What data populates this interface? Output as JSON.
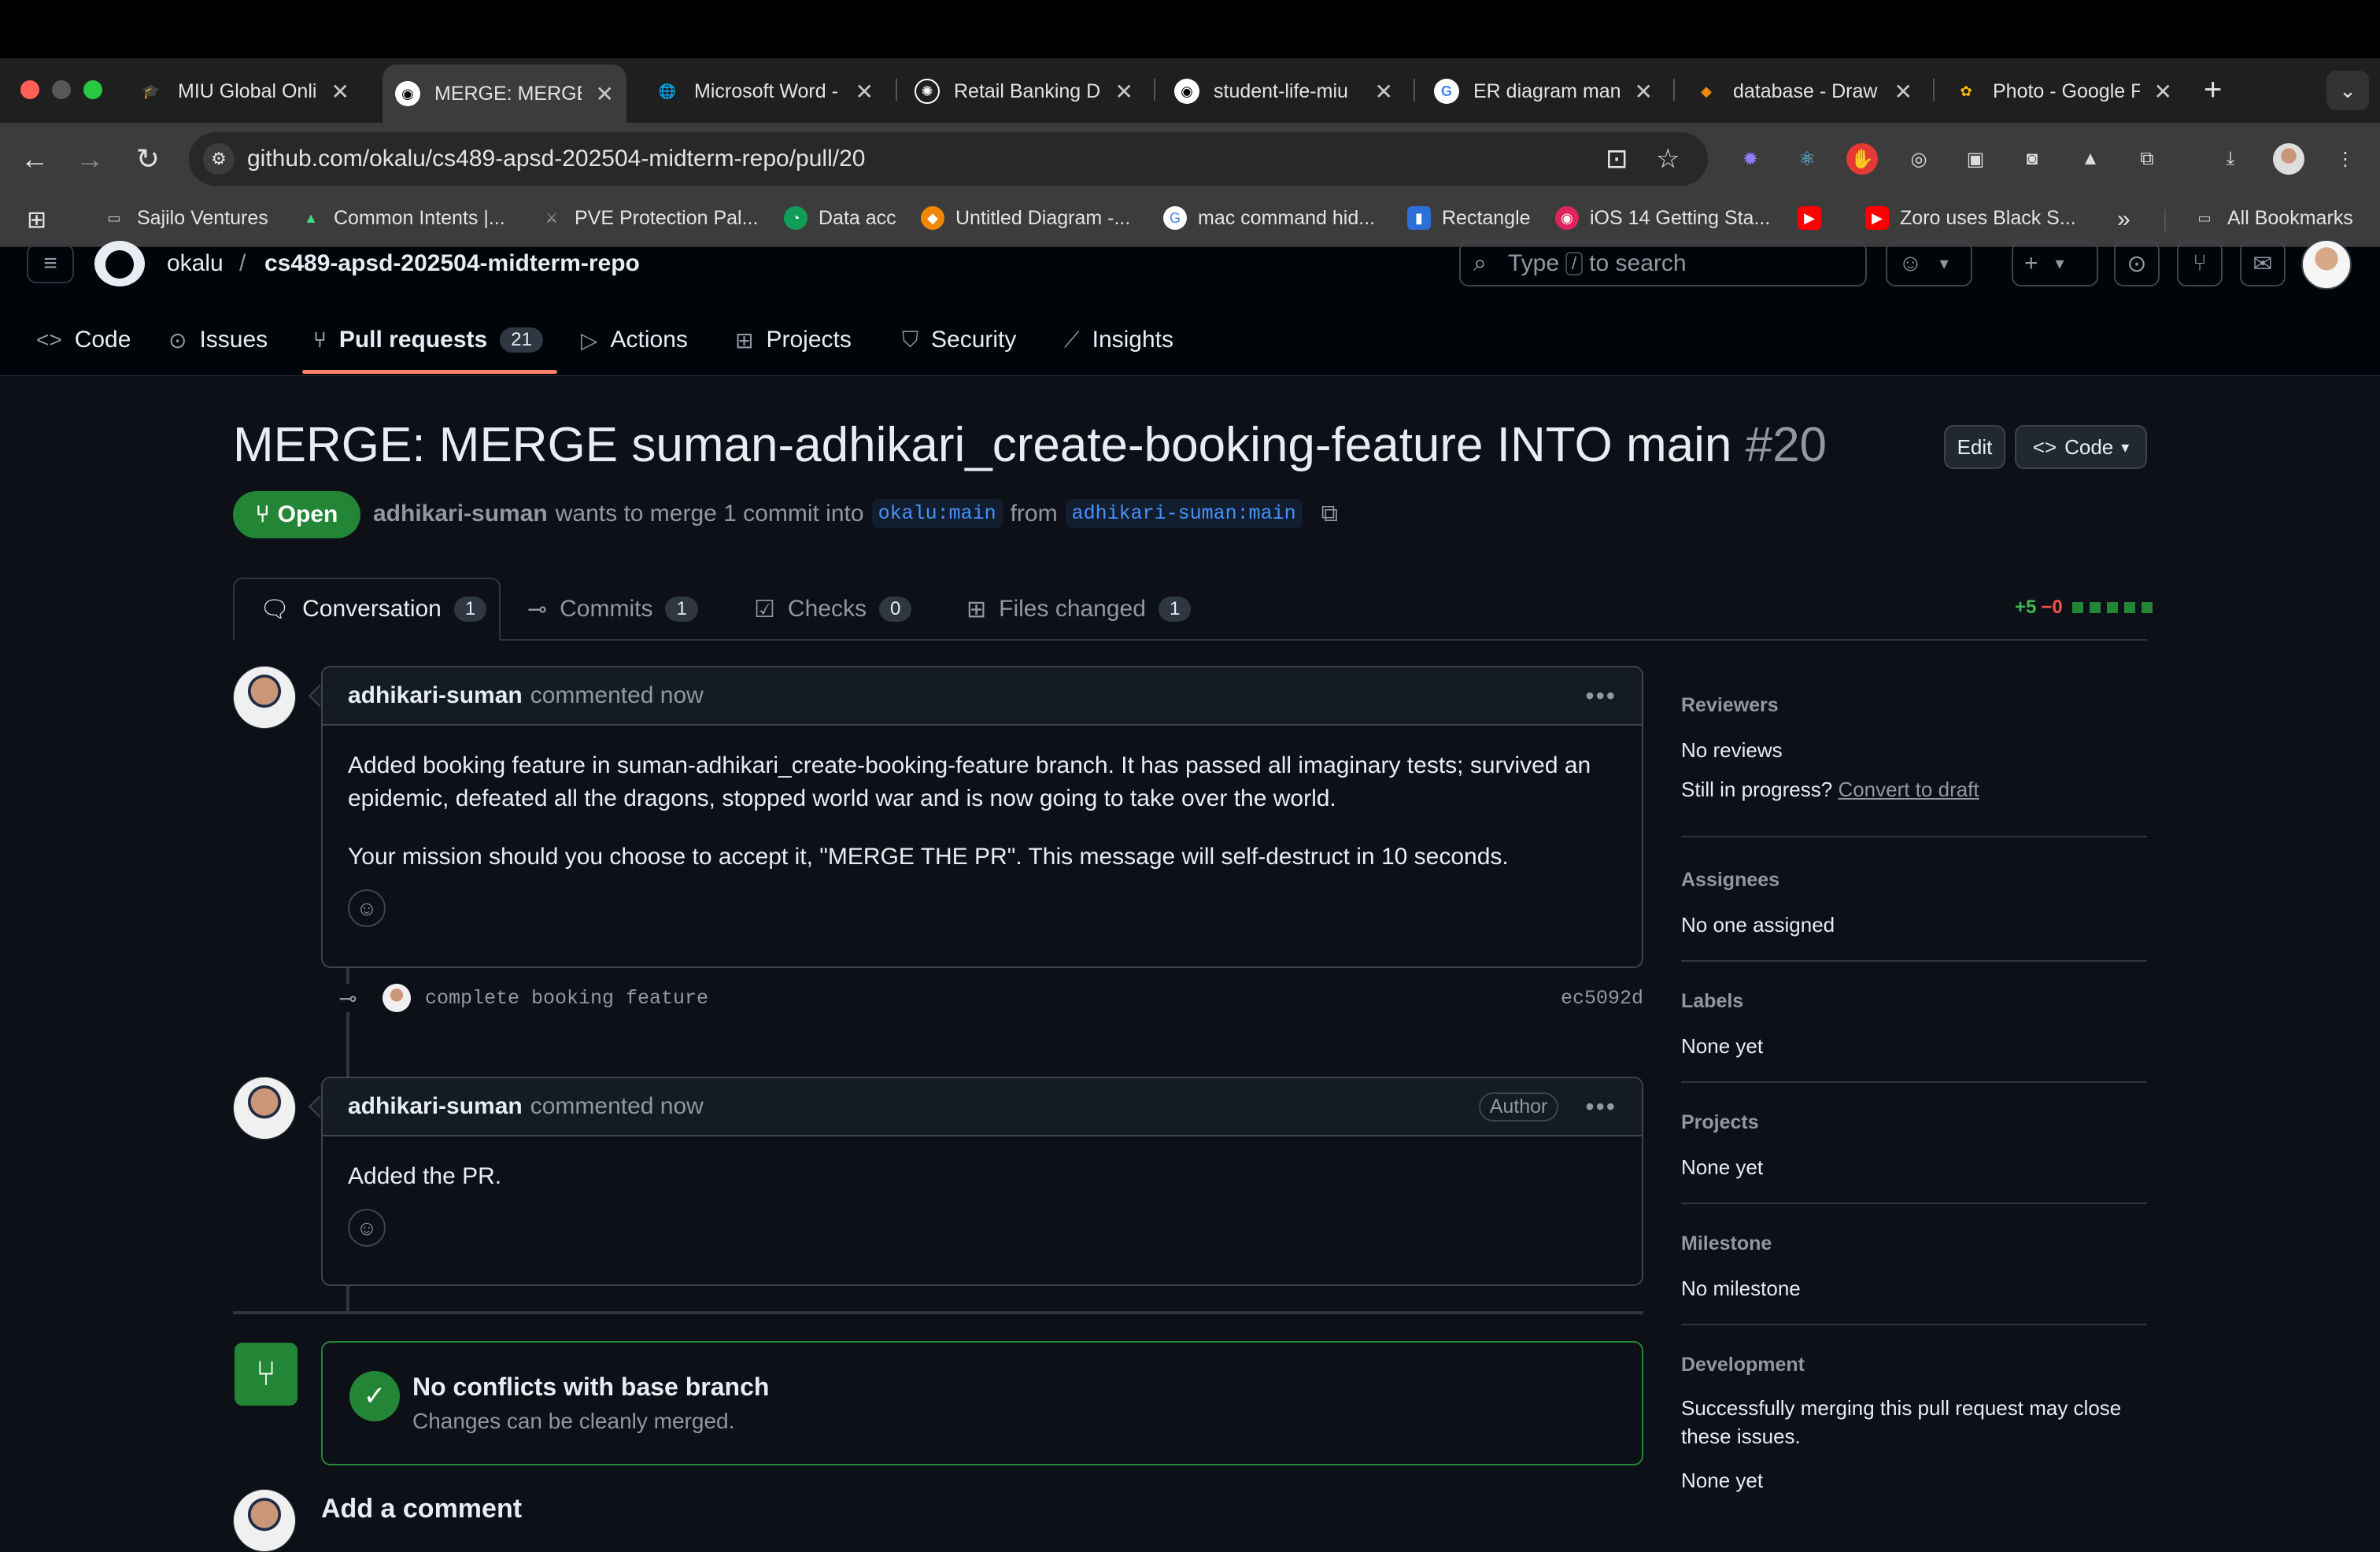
{
  "browser": {
    "tabs": [
      {
        "title": "MIU Global Onlin",
        "icon": "graduation-icon",
        "color": "#4f8fe8"
      },
      {
        "title": "MERGE: MERGE",
        "icon": "github-icon",
        "color": "#ffffff",
        "active": true
      },
      {
        "title": "Microsoft Word -",
        "icon": "globe-icon",
        "color": "#9aa0a6"
      },
      {
        "title": "Retail Banking D",
        "icon": "openai-icon",
        "color": "#ffffff"
      },
      {
        "title": "student-life-miu",
        "icon": "github-icon",
        "color": "#ffffff"
      },
      {
        "title": "ER diagram man",
        "icon": "google-icon",
        "color": "#4285f4"
      },
      {
        "title": "database - Draw",
        "icon": "drawio-icon",
        "color": "#f08705"
      },
      {
        "title": "Photo - Google F",
        "icon": "google-photos-icon",
        "color": "#fbbc04"
      }
    ],
    "url": "github.com/okalu/cs489-apsd-202504-midterm-repo/pull/20",
    "bookmarks": [
      {
        "label": "Sajilo Ventures",
        "icon": "folder-icon"
      },
      {
        "label": "Common Intents |...",
        "icon": "android-icon"
      },
      {
        "label": "PVE Protection Pal...",
        "icon": "sword-icon"
      },
      {
        "label": "Data acc",
        "icon": "chart-icon"
      },
      {
        "label": "Untitled Diagram -...",
        "icon": "drawio-icon"
      },
      {
        "label": "mac command hid...",
        "icon": "google-icon"
      },
      {
        "label": "Rectangle",
        "icon": "rectangle-icon"
      },
      {
        "label": "iOS 14 Getting Sta...",
        "icon": "ios-icon"
      },
      {
        "label": "",
        "icon": "youtube-icon"
      },
      {
        "label": "Zoro uses Black S...",
        "icon": "youtube-icon"
      }
    ],
    "all_bookmarks": "All Bookmarks"
  },
  "repo": {
    "owner": "okalu",
    "sep": "/",
    "name": "cs489-apsd-202504-midterm-repo",
    "search_prefix": "Type",
    "search_key": "/",
    "search_suffix": "to search",
    "nav": [
      {
        "label": "Code",
        "icon": "code-icon"
      },
      {
        "label": "Issues",
        "icon": "issue-icon"
      },
      {
        "label": "Pull requests",
        "icon": "pull-request-icon",
        "count": "21",
        "active": true
      },
      {
        "label": "Actions",
        "icon": "play-icon"
      },
      {
        "label": "Projects",
        "icon": "table-icon"
      },
      {
        "label": "Security",
        "icon": "shield-icon"
      },
      {
        "label": "Insights",
        "icon": "graph-icon"
      }
    ]
  },
  "pr": {
    "title": "MERGE: MERGE suman-adhikari_create-booking-feature INTO main",
    "number": "#20",
    "edit_label": "Edit",
    "code_label": "Code",
    "state": "Open",
    "author": "adhikari-suman",
    "meta_text": "wants to merge 1 commit into",
    "base_branch": "okalu:main",
    "from_text": "from",
    "head_branch": "adhikari-suman:main",
    "tabs": [
      {
        "label": "Conversation",
        "count": "1"
      },
      {
        "label": "Commits",
        "count": "1"
      },
      {
        "label": "Checks",
        "count": "0"
      },
      {
        "label": "Files changed",
        "count": "1"
      }
    ],
    "additions": "+5",
    "deletions": "−0"
  },
  "comments": [
    {
      "author": "adhikari-suman",
      "action": "commented now",
      "paragraphs": [
        "Added booking feature in suman-adhikari_create-booking-feature branch. It has passed all imaginary tests; survived an epidemic, defeated all the dragons, stopped world war and is now going to take over the world.",
        "Your mission should you choose to accept it, \"MERGE THE PR\". This message will self-destruct in 10 seconds."
      ]
    },
    {
      "author": "adhikari-suman",
      "action": "commented now",
      "badge": "Author",
      "paragraphs": [
        "Added the PR."
      ]
    }
  ],
  "commit": {
    "message": "complete booking feature",
    "sha": "ec5092d"
  },
  "merge": {
    "title": "No conflicts with base branch",
    "subtitle": "Changes can be cleanly merged."
  },
  "add_comment": "Add a comment",
  "sidebar": [
    {
      "heading": "Reviewers",
      "value": "No reviews",
      "extra_text": "Still in progress?",
      "extra_link": "Convert to draft"
    },
    {
      "heading": "Assignees",
      "value": "No one assigned"
    },
    {
      "heading": "Labels",
      "value": "None yet"
    },
    {
      "heading": "Projects",
      "value": "None yet"
    },
    {
      "heading": "Milestone",
      "value": "No milestone"
    },
    {
      "heading": "Development",
      "value": "Successfully merging this pull request may close these issues.",
      "value2": "None yet"
    }
  ],
  "colors": {
    "accent_green": "#238636",
    "link_blue": "#4493f8",
    "tab_underline": "#f78166"
  }
}
